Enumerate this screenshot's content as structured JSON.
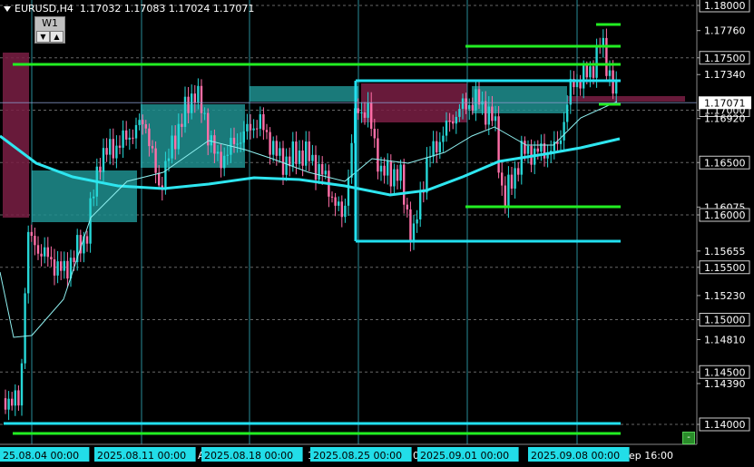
{
  "header": {
    "symbol": "EURUSD,H4",
    "ohlc": "1.17032 1.17083 1.17024 1.17071"
  },
  "timeframe_button": {
    "label": "W1",
    "down": "▼",
    "up": "▲"
  },
  "price_axis": [
    {
      "label": "1.18000",
      "value": 1.18,
      "boxed": true
    },
    {
      "label": "1.17760",
      "value": 1.1776,
      "boxed": false
    },
    {
      "label": "1.17500",
      "value": 1.175,
      "boxed": true
    },
    {
      "label": "1.17340",
      "value": 1.1734,
      "boxed": false
    },
    {
      "label": "1.17000",
      "value": 1.17,
      "boxed": true
    },
    {
      "label": "1.16920",
      "value": 1.1692,
      "boxed": false
    },
    {
      "label": "1.16500",
      "value": 1.165,
      "boxed": true
    },
    {
      "label": "1.16075",
      "value": 1.16075,
      "boxed": false
    },
    {
      "label": "1.16000",
      "value": 1.16,
      "boxed": true
    },
    {
      "label": "1.15655",
      "value": 1.15655,
      "boxed": false
    },
    {
      "label": "1.15500",
      "value": 1.155,
      "boxed": true
    },
    {
      "label": "1.15230",
      "value": 1.1523,
      "boxed": false
    },
    {
      "label": "1.15000",
      "value": 1.15,
      "boxed": true
    },
    {
      "label": "1.14810",
      "value": 1.1481,
      "boxed": false
    },
    {
      "label": "1.14500",
      "value": 1.145,
      "boxed": true
    },
    {
      "label": "1.14390",
      "value": 1.1439,
      "boxed": false
    },
    {
      "label": "1.14000",
      "value": 1.14,
      "boxed": true
    }
  ],
  "current_price": {
    "label": "1.17071",
    "value": 1.17071
  },
  "time_axis": [
    {
      "label": "25.08.04 00:00",
      "boxed": true
    },
    {
      "label": "2025.08.11 00:00",
      "boxed": true
    },
    {
      "label": "A",
      "boxed": false
    },
    {
      "label": "2025.08.18 00:00",
      "boxed": true
    },
    {
      "label": "1",
      "boxed": false
    },
    {
      "label": "2025.08.25 00:00",
      "boxed": true
    },
    {
      "label": "0",
      "boxed": false
    },
    {
      "label": "2025.09.01 00:00",
      "boxed": true
    },
    {
      "label": "2025.09.08 00:00",
      "boxed": true
    },
    {
      "label": "ep 16:00",
      "boxed": false
    }
  ],
  "colors": {
    "background": "#000000",
    "bull": "#26d7d7",
    "bear": "#ff6fa8",
    "ma_slow": "#2ee6f0",
    "ma_fast": "#8ff0f0",
    "level_green": "#22ee22",
    "level_cyan": "#22e0f0",
    "zone_teal": "#1f8f8f",
    "zone_maroon": "#7a1f44",
    "grid": "#666666",
    "session_line": "#3ac8d8"
  },
  "corner_button": "-"
}
